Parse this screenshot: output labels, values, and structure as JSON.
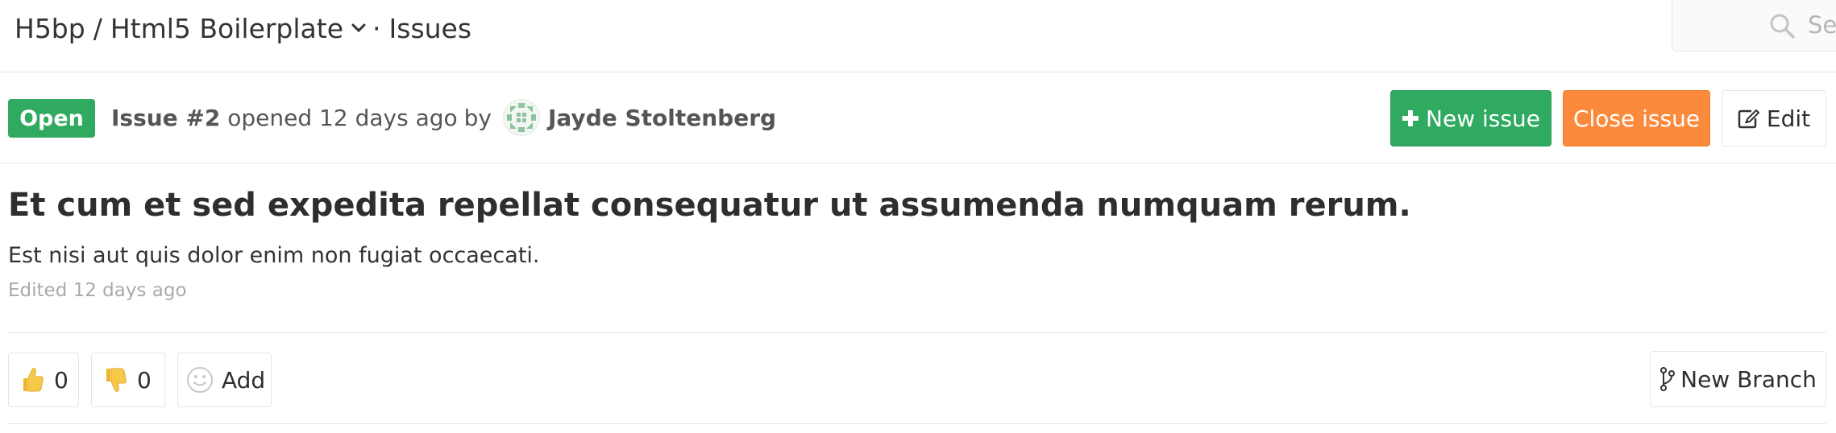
{
  "header": {
    "namespace": "H5bp",
    "separator": "/",
    "project": "Html5 Boilerplate",
    "section_separator": "·",
    "section": "Issues",
    "search_placeholder": "Sea"
  },
  "issue": {
    "status": "Open",
    "number": "Issue #2",
    "opened_text": "opened 12 days ago",
    "by_text": "by",
    "author": "Jayde Stoltenberg",
    "title": "Et cum et sed expedita repellat consequatur ut assumenda numquam rerum.",
    "description": "Est nisi aut quis dolor enim non fugiat occaecati.",
    "edited": "Edited 12 days ago"
  },
  "actions": {
    "new_issue": "New issue",
    "close_issue": "Close issue",
    "edit": "Edit",
    "new_branch": "New Branch"
  },
  "awards": {
    "thumbs_up_count": "0",
    "thumbs_down_count": "0",
    "add_label": "Add"
  },
  "colors": {
    "open_badge": "#2faa60",
    "new_issue": "#2faa60",
    "close_issue": "#fc8a3c",
    "emoji_yellow": "#f7c948"
  },
  "icons": {
    "breadcrumb_dropdown": "chevron-down-icon",
    "search": "search-icon",
    "avatar": "identicon",
    "new_issue": "plus-icon",
    "edit": "pencil-square-icon",
    "thumbs_up": "thumbs-up-icon",
    "thumbs_down": "thumbs-down-icon",
    "add_emoji": "smiley-icon",
    "new_branch": "branch-icon"
  }
}
